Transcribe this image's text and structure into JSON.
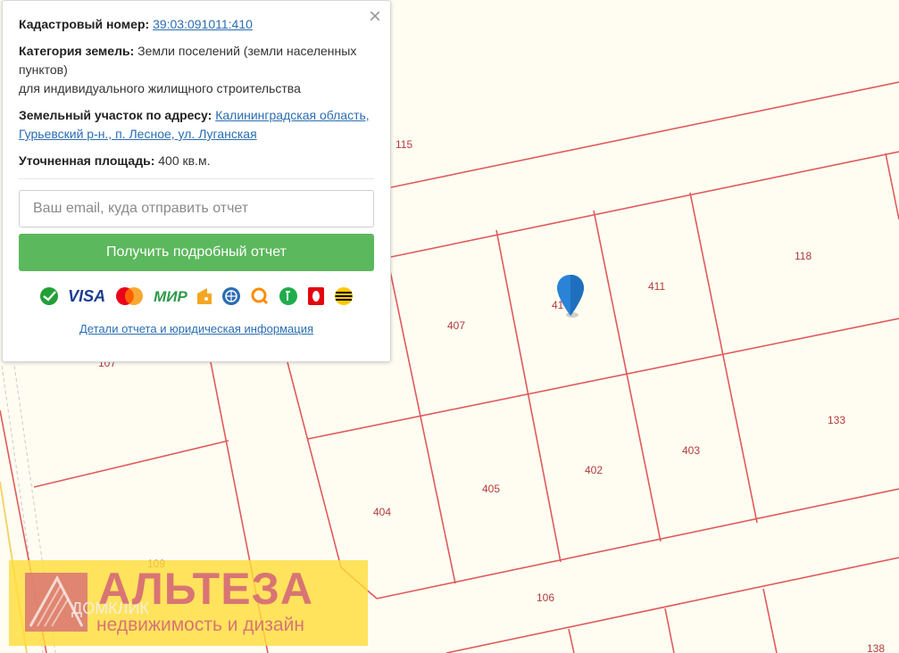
{
  "popup": {
    "cadastral_label": "Кадастровый номер:",
    "cadastral_value": "39:03:091011:410",
    "category_label": "Категория земель:",
    "category_value": "Земли поселений (земли населенных пунктов)",
    "category_use": "для индивидуального жилищного строительства",
    "address_label": "Земельный участок по адресу:",
    "address_value": "Калининградская область, Гурьевский р-н., п. Лесное, ул. Луганская",
    "area_label": "Уточненная площадь:",
    "area_value": "400 кв.м.",
    "close_icon": "×",
    "email_placeholder": "Ваш email, куда отправить отчет",
    "report_button": "Получить подробный отчет",
    "payment_icons": [
      "sberbank-icon",
      "visa-icon",
      "mastercard-icon",
      "mir-icon",
      "yandex-money-icon",
      "webmoney-icon",
      "qiwi-icon",
      "sberbank-online-icon",
      "mts-icon",
      "beeline-icon"
    ],
    "visa_text": "VISA",
    "mir_text": "МИР",
    "details_link": "Детали отчета и юридическая информация"
  },
  "map": {
    "plot_labels": [
      "115",
      "118",
      "411",
      "41",
      "407",
      "107",
      "133",
      "403",
      "402",
      "405",
      "404",
      "109",
      "106",
      "138"
    ],
    "accent_color": "#e05a5a",
    "marker_color": "#2a83d6"
  },
  "watermark": {
    "title": "АЛЬТЕЗА",
    "subtitle": "недвижимость и дизайн",
    "domclick": "ДОМКЛИК"
  }
}
